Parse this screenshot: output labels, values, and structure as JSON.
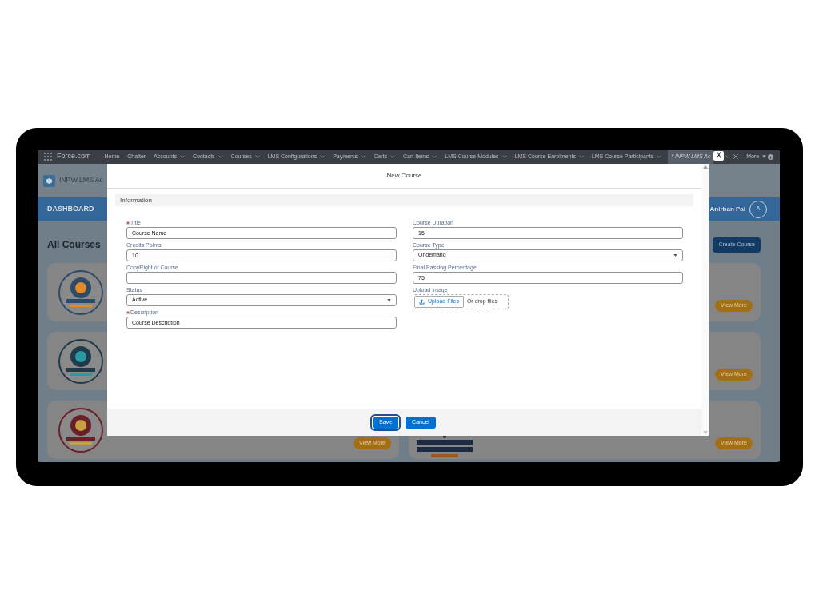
{
  "nav": {
    "app_name": "Force.com",
    "items": [
      {
        "label": "Home",
        "has_menu": false
      },
      {
        "label": "Chatter",
        "has_menu": false
      },
      {
        "label": "Accounts",
        "has_menu": true
      },
      {
        "label": "Contacts",
        "has_menu": true
      },
      {
        "label": "Courses",
        "has_menu": true
      },
      {
        "label": "LMS Configurations",
        "has_menu": true
      },
      {
        "label": "Payments",
        "has_menu": true
      },
      {
        "label": "Carts",
        "has_menu": true
      },
      {
        "label": "Cart Items",
        "has_menu": true
      },
      {
        "label": "LMS Course Modules",
        "has_menu": true
      },
      {
        "label": "LMS Course Enrolments",
        "has_menu": true
      },
      {
        "label": "LMS Course Participants",
        "has_menu": true
      }
    ],
    "open_tab": {
      "label": "* INPW LMS Ac",
      "selected": true
    },
    "close_label": "X",
    "more": "More"
  },
  "app_header": {
    "title": "INPW LMS Ac"
  },
  "app_bar": {
    "tab": "DASHBOARD",
    "user": "Anirban Pal",
    "avatar": "A"
  },
  "page": {
    "heading": "All Courses",
    "create_button": "Create Course",
    "left_cards": [
      {
        "kind": "picture"
      },
      {
        "kind": "picture"
      },
      {
        "kind": "picture",
        "view_more": "View More"
      }
    ],
    "right_cards": [
      {
        "view_more": "View More"
      },
      {
        "view_more": "View More"
      },
      {
        "kind": "picture",
        "view_more": "View More"
      }
    ]
  },
  "modal": {
    "title": "New Course",
    "section": "Information",
    "left_fields": [
      {
        "label": "Title",
        "required": true,
        "kind": "text",
        "value": "Course Name"
      },
      {
        "label": "Credits Points",
        "required": false,
        "kind": "text",
        "value": "10"
      },
      {
        "label": "CopyRight of Course",
        "required": false,
        "kind": "text"
      },
      {
        "label": "Status",
        "required": false,
        "kind": "select",
        "value": "Active"
      },
      {
        "label": "Description",
        "required": true,
        "kind": "text",
        "value": "Course Description"
      }
    ],
    "right_fields": [
      {
        "label": "Course Duration",
        "required": false,
        "kind": "text",
        "value": "15"
      },
      {
        "label": "Course Type",
        "required": false,
        "kind": "select",
        "value": "Ondemand"
      },
      {
        "label": "Final Passing Percentage",
        "required": false,
        "kind": "text",
        "value": "75"
      },
      {
        "label": "Upload Image",
        "required": false,
        "kind": "upload",
        "button": "Upload Files",
        "drop_text": "Or drop files"
      }
    ],
    "buttons": [
      {
        "label": "Save",
        "focused": true
      },
      {
        "label": "Cancel",
        "focused": false
      }
    ]
  }
}
